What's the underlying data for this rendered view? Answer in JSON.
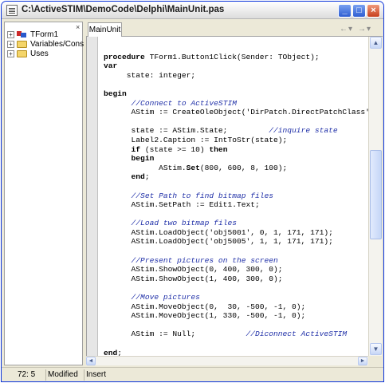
{
  "window": {
    "title": "C:\\ActiveSTIM\\DemoCode\\Delphi\\MainUnit.pas",
    "controls": {
      "minimize": "_",
      "maximize": "□",
      "close": "×"
    }
  },
  "tree": {
    "close_glyph": "×",
    "items": [
      {
        "label": "TForm1",
        "expander": "+"
      },
      {
        "label": "Variables/Constants",
        "expander": "+"
      },
      {
        "label": "Uses",
        "expander": "+"
      }
    ]
  },
  "editor": {
    "tab_label": "MainUnit",
    "nav": {
      "back": "←",
      "back_menu": "▾",
      "forward": "→",
      "forward_menu": "▾"
    }
  },
  "code_lines": [
    "",
    "procedure TForm1.Button1Click(Sender: TObject);",
    "var",
    "     state: integer;",
    "",
    "begin",
    "      //Connect to ActiveSTIM",
    "      AStim := CreateOleObject('DirPatch.DirectPatchClass');",
    "",
    "      state := AStim.State;         //inquire state",
    "      Label2.Caption := IntToStr(state);",
    "      if (state >= 10) then",
    "      begin",
    "            AStim.Set(800, 600, 8, 100);",
    "      end;",
    "",
    "      //Set Path to find bitmap files",
    "      AStim.SetPath := Edit1.Text;",
    "",
    "      //Load two bitmap files",
    "      AStim.LoadObject('obj5001', 0, 1, 171, 171);",
    "      AStim.LoadObject('obj5005', 1, 1, 171, 171);",
    "",
    "      //Present pictures on the screen",
    "      AStim.ShowObject(0, 400, 300, 0);",
    "      AStim.ShowObject(1, 400, 300, 0);",
    "",
    "      //Move pictures",
    "      AStim.MoveObject(0,  30, -500, -1, 0);",
    "      AStim.MoveObject(1, 330, -500, -1, 0);",
    "",
    "      AStim := Null;           //Diconnect ActiveSTIM",
    "",
    "end;"
  ],
  "scrollbars": {
    "up": "▲",
    "down": "▼",
    "left": "◄",
    "right": "►"
  },
  "statusbar": {
    "position": "72:  5",
    "modified": "Modified",
    "mode": "Insert"
  }
}
